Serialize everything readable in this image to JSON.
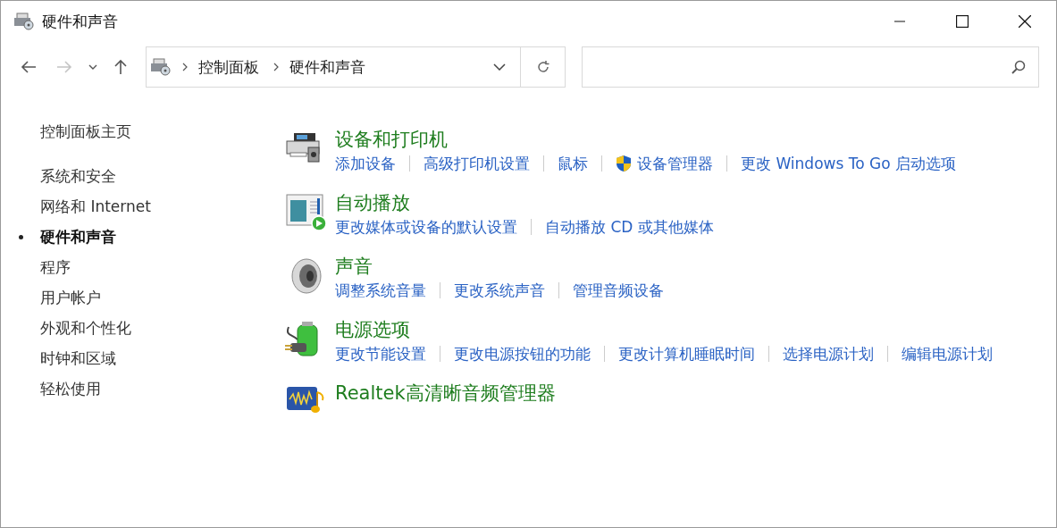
{
  "window": {
    "title": "硬件和声音",
    "controls": [
      {
        "kind": "minimize"
      },
      {
        "kind": "maximize"
      },
      {
        "kind": "close"
      }
    ]
  },
  "nav": [
    {
      "kind": "back",
      "disabled": false
    },
    {
      "kind": "forward",
      "disabled": true
    },
    {
      "kind": "recent",
      "disabled": false
    },
    {
      "kind": "up",
      "disabled": false
    }
  ],
  "address": {
    "crumbs": [
      "控制面板",
      "硬件和声音"
    ]
  },
  "sidebar": {
    "items": [
      {
        "label": "控制面板主页",
        "selected": false
      },
      {
        "label": "系统和安全",
        "selected": false
      },
      {
        "label": "网络和 Internet",
        "selected": false
      },
      {
        "label": "硬件和声音",
        "selected": true
      },
      {
        "label": "程序",
        "selected": false
      },
      {
        "label": "用户帐户",
        "selected": false
      },
      {
        "label": "外观和个性化",
        "selected": false
      },
      {
        "label": "时钟和区域",
        "selected": false
      },
      {
        "label": "轻松使用",
        "selected": false
      }
    ]
  },
  "sections": [
    {
      "kind": "printer",
      "title": "设备和打印机",
      "links": [
        {
          "label": "添加设备",
          "shield": false
        },
        {
          "label": "高级打印机设置",
          "shield": false
        },
        {
          "label": "鼠标",
          "shield": false
        },
        {
          "label": "设备管理器",
          "shield": true
        },
        {
          "label": "更改 Windows To Go 启动选项",
          "shield": false
        }
      ]
    },
    {
      "kind": "autoplay",
      "title": "自动播放",
      "links": [
        {
          "label": "更改媒体或设备的默认设置",
          "shield": false
        },
        {
          "label": "自动播放 CD 或其他媒体",
          "shield": false
        }
      ]
    },
    {
      "kind": "speaker",
      "title": "声音",
      "links": [
        {
          "label": "调整系统音量",
          "shield": false
        },
        {
          "label": "更改系统声音",
          "shield": false
        },
        {
          "label": "管理音频设备",
          "shield": false
        }
      ]
    },
    {
      "kind": "battery",
      "title": "电源选项",
      "links": [
        {
          "label": "更改节能设置",
          "shield": false
        },
        {
          "label": "更改电源按钮的功能",
          "shield": false
        },
        {
          "label": "更改计算机睡眠时间",
          "shield": false
        },
        {
          "label": "选择电源计划",
          "shield": false
        },
        {
          "label": "编辑电源计划",
          "shield": false
        }
      ]
    },
    {
      "kind": "realtek",
      "title": "Realtek高清晰音频管理器"
    }
  ]
}
